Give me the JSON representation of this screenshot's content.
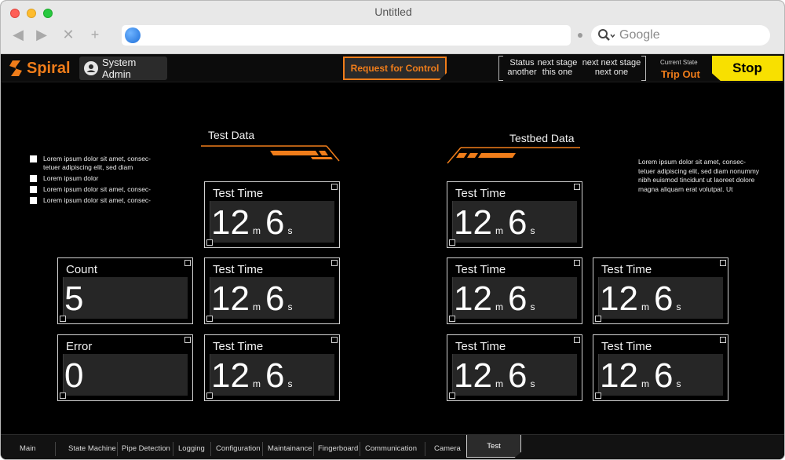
{
  "window": {
    "title": "Untitled"
  },
  "browser": {
    "search_placeholder": "Google"
  },
  "app": {
    "logo": "Spiral",
    "user": "System Admin",
    "request_button": "Request for Control",
    "status": [
      {
        "top": "Status",
        "bottom": "another"
      },
      {
        "top": "next stage",
        "bottom": "this one"
      },
      {
        "top": "next next stage",
        "bottom": "next one"
      }
    ],
    "current_state_label": "Current State",
    "current_state_value": "Trip Out",
    "stop_button": "Stop"
  },
  "test_data": {
    "title": "Test Data"
  },
  "testbed_data": {
    "title": "Testbed Data"
  },
  "checklist": [
    "Lorem ipsum dolor sit amet, consec- tetuer adipiscing elit, sed diam",
    "Lorem ipsum dolor",
    "Lorem ipsum dolor sit amet, consec-",
    "Lorem ipsum dolor sit amet, consec-"
  ],
  "paragraph": "Lorem ipsum dolor sit amet, consec- tetuer adipiscing elit, sed diam nonummy nibh euismod tincidunt ut laoreet dolore magna aliquam erat volutpat. Ut",
  "cards": {
    "count": {
      "label": "Count",
      "value": "5"
    },
    "error": {
      "label": "Error",
      "value": "0"
    },
    "test_time": {
      "label": "Test Time",
      "minutes": "12",
      "m_unit": "m",
      "seconds": "6",
      "s_unit": "s"
    }
  },
  "tabs": [
    "Main",
    "State Machine",
    "Pipe Detection",
    "Logging",
    "Configuration",
    "Maintainance",
    "Fingerboard",
    "Communication",
    "Camera",
    "Test"
  ],
  "colors": {
    "accent": "#f07d1a",
    "stop": "#f8e000",
    "background": "#000000"
  }
}
